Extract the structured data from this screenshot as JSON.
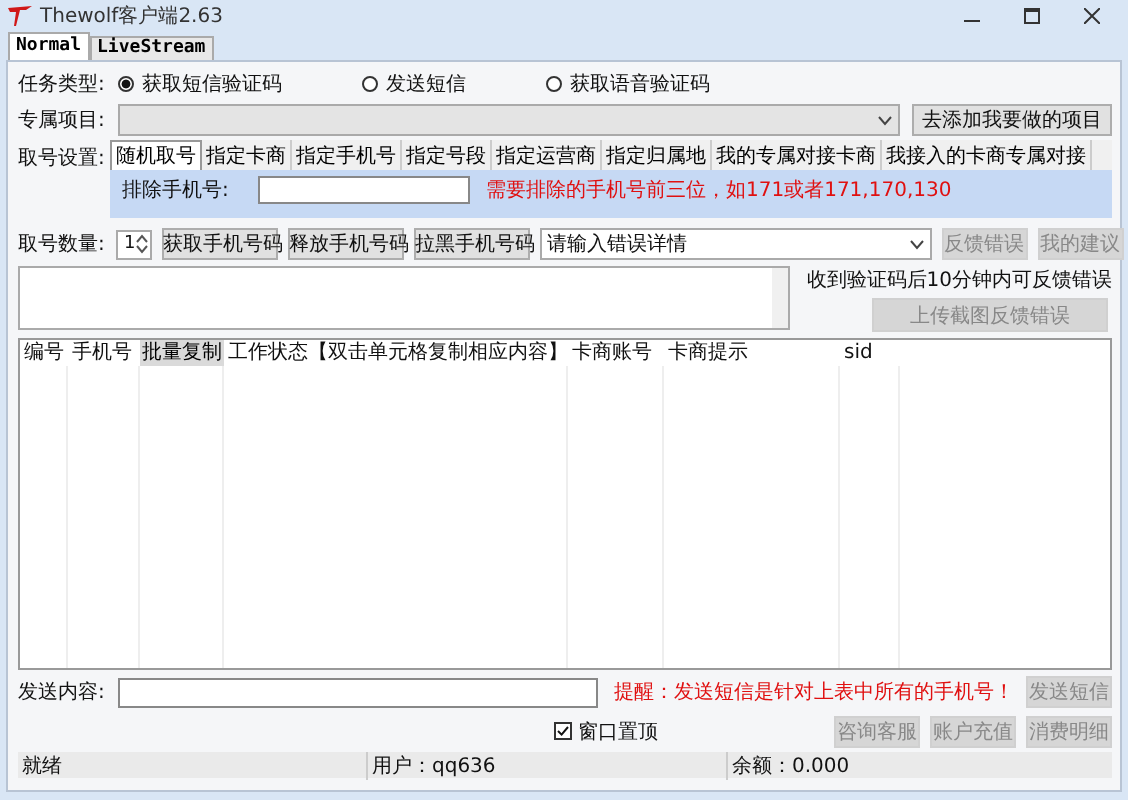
{
  "window": {
    "title": "Thewolf客户端2.63"
  },
  "tabs": [
    {
      "label": "Normal",
      "selected": true
    },
    {
      "label": "LiveStream",
      "selected": false
    }
  ],
  "task_type": {
    "label": "任务类型:",
    "options": [
      {
        "label": "获取短信验证码",
        "selected": true
      },
      {
        "label": "发送短信",
        "selected": false
      },
      {
        "label": "获取语音验证码",
        "selected": false
      }
    ]
  },
  "project": {
    "label": "专属项目:",
    "disabled": true,
    "button": "去添加我要做的项目"
  },
  "number_settings": {
    "label": "取号设置:",
    "tabs": [
      {
        "label": "随机取号",
        "selected": true
      },
      {
        "label": "指定卡商",
        "selected": false
      },
      {
        "label": "指定手机号",
        "selected": false
      },
      {
        "label": "指定号段",
        "selected": false
      },
      {
        "label": "指定运营商",
        "selected": false
      },
      {
        "label": "指定归属地",
        "selected": false
      },
      {
        "label": "我的专属对接卡商",
        "selected": false
      },
      {
        "label": "我接入的卡商专属对接",
        "selected": false
      }
    ],
    "exclude_label": "排除手机号:",
    "exclude_hint": "需要排除的手机号前三位，如171或者171,170,130"
  },
  "quantity": {
    "label": "取号数量:",
    "value": "1",
    "buttons": [
      "获取手机号码",
      "释放手机号码",
      "拉黑手机号码"
    ],
    "error_detail": "请输入错误详情",
    "right_buttons": [
      {
        "label": "反馈错误",
        "disabled": true
      },
      {
        "label": "我的建议",
        "disabled": true
      }
    ]
  },
  "feedback": {
    "note": "收到验证码后10分钟内可反馈错误",
    "button": {
      "label": "上传截图反馈错误",
      "disabled": true
    }
  },
  "table": {
    "columns": [
      {
        "label": "编号",
        "kind": "text"
      },
      {
        "label": "手机号",
        "kind": "text"
      },
      {
        "label": "批量复制",
        "kind": "button"
      },
      {
        "label": "工作状态【双击单元格复制相应内容】",
        "kind": "text"
      },
      {
        "label": "卡商账号",
        "kind": "text"
      },
      {
        "label": "卡商提示",
        "kind": "text"
      },
      {
        "label": "sid",
        "kind": "text"
      }
    ]
  },
  "send": {
    "label": "发送内容:",
    "warning": "提醒：发送短信是针对上表中所有的手机号！",
    "button": {
      "label": "发送短信",
      "disabled": true
    }
  },
  "topmost": {
    "label": "窗口置顶",
    "checked": true
  },
  "bottom_buttons": [
    {
      "label": "咨询客服",
      "disabled": true
    },
    {
      "label": "账户充值",
      "disabled": true
    },
    {
      "label": "消费明细",
      "disabled": true
    }
  ],
  "status_bar": [
    "就绪",
    "用户：qq636",
    "余额：0.000"
  ]
}
